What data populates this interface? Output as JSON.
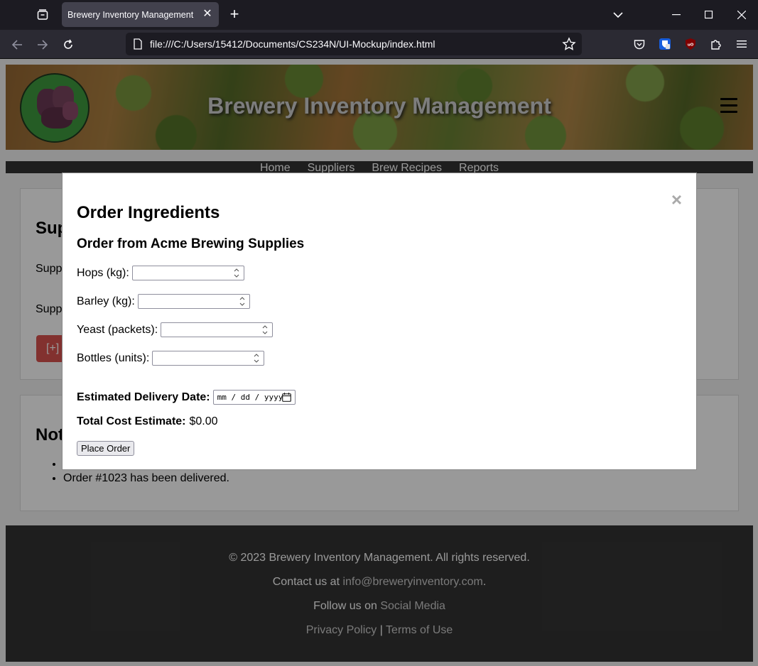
{
  "browser": {
    "tab_title": "Brewery Inventory Management",
    "new_tab_symbol": "+",
    "tab_close_symbol": "✕",
    "url": "file:///C:/Users/15412/Documents/CS234N/UI-Mockup/index.html"
  },
  "header": {
    "site_title": "Brewery Inventory Management"
  },
  "nav": {
    "items": [
      "Home",
      "Suppliers",
      "Brew Recipes",
      "Reports"
    ]
  },
  "background": {
    "section1_title": "Sup",
    "section1_line1": "Supp",
    "section1_line2": "Supp",
    "add_button": "[+]",
    "section2_title": "Not",
    "notifications": [
      "",
      "Order #1023 has been delivered."
    ]
  },
  "modal": {
    "close_symbol": "×",
    "title": "Order Ingredients",
    "subtitle": "Order from Acme Brewing Supplies",
    "fields": [
      {
        "label": "Hops (kg):",
        "value": ""
      },
      {
        "label": "Barley (kg):",
        "value": ""
      },
      {
        "label": "Yeast (packets):",
        "value": ""
      },
      {
        "label": "Bottles (units):",
        "value": ""
      }
    ],
    "delivery_label": "Estimated Delivery Date:",
    "delivery_placeholder": "mm / dd / yyyy",
    "cost_label": "Total Cost Estimate:",
    "cost_value": "$0.00",
    "place_order": "Place Order"
  },
  "footer": {
    "copyright": "© 2023 Brewery Inventory Management. All rights reserved.",
    "contact_prefix": "Contact us at ",
    "contact_email": "info@breweryinventory.com",
    "contact_suffix": ".",
    "follow_prefix": "Follow us on ",
    "follow_link": "Social Media",
    "privacy": "Privacy Policy",
    "separator": " | ",
    "terms": "Terms of Use"
  }
}
